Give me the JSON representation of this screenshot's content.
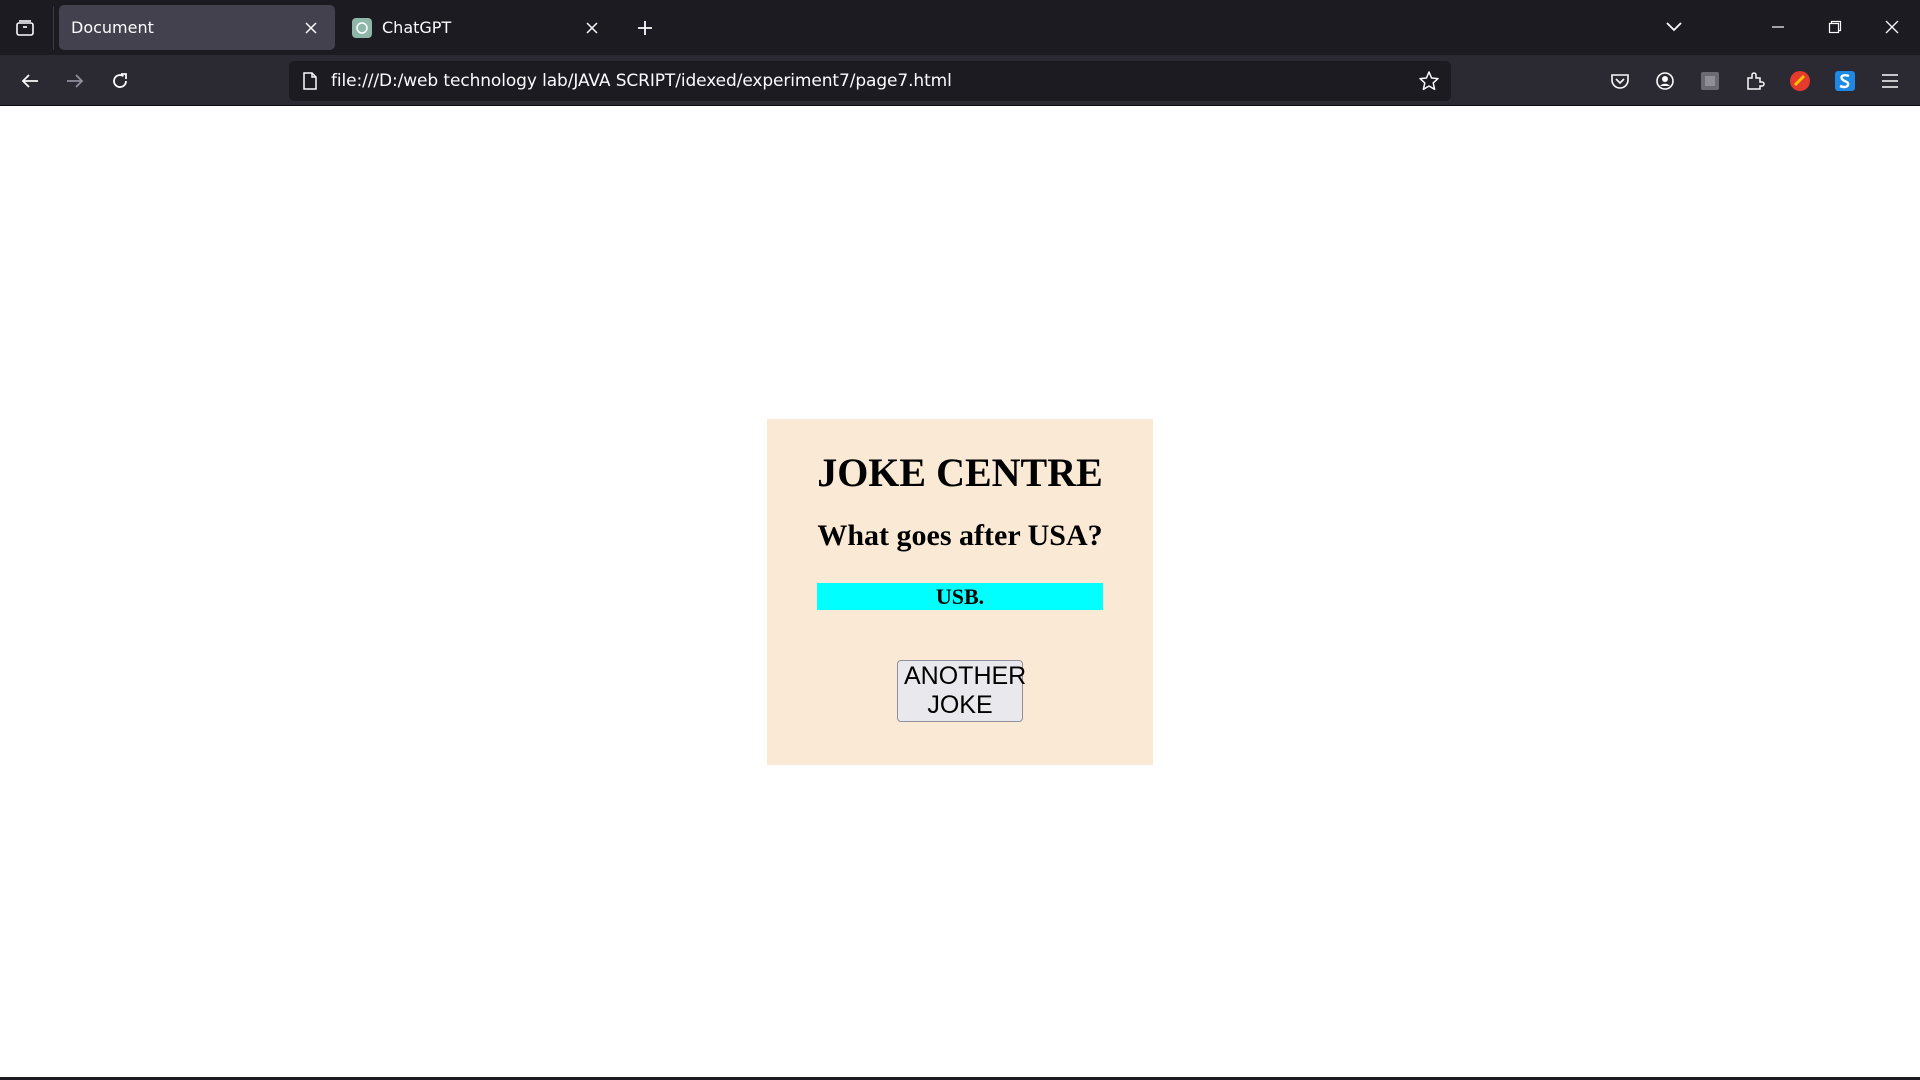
{
  "browser": {
    "tabs": [
      {
        "title": "Document",
        "active": true
      },
      {
        "title": "ChatGPT",
        "active": false
      }
    ],
    "url": "file:///D:/web technology lab/JAVA SCRIPT/idexed/experiment7/page7.html",
    "icons": [
      "tab-list-icon",
      "close-icon",
      "chatgpt-favicon",
      "plus-icon",
      "chevron-down-icon",
      "minimize-icon",
      "restore-icon",
      "close-window-icon",
      "back-arrow-icon",
      "forward-arrow-icon",
      "reload-icon",
      "page-icon",
      "star-icon",
      "pocket-icon",
      "account-icon",
      "extension-square-icon",
      "puzzle-icon",
      "colorful-extension-icon",
      "s-extension-icon",
      "menu-icon"
    ]
  },
  "page": {
    "title": "JOKE CENTRE",
    "question": "What goes after USA?",
    "answer": "USB.",
    "button_label": "ANOTHER JOKE",
    "box_color": "#f9e9d5",
    "answer_color": "#00ffff"
  }
}
